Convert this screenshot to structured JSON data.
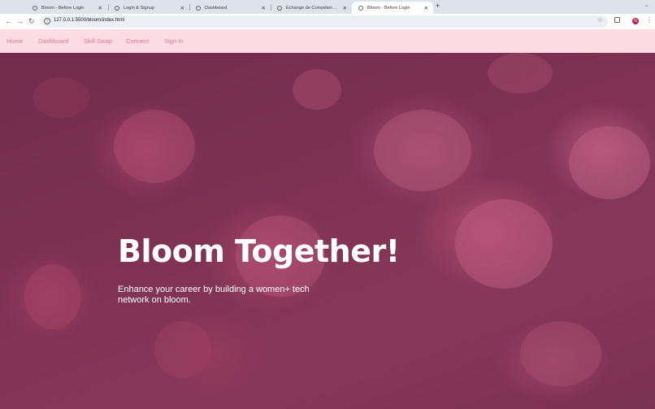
{
  "browser": {
    "tabs": [
      {
        "title": "Bloom - Before Login",
        "active": false
      },
      {
        "title": "Login & Signup",
        "active": false
      },
      {
        "title": "Dashboard",
        "active": false
      },
      {
        "title": "Échange de Compétences - S",
        "active": false
      },
      {
        "title": "Bloom - Before Login",
        "active": true
      }
    ],
    "new_tab": "+",
    "url": "127.0.0.1:5500/bloom/index.html",
    "profile_initial": "N"
  },
  "nav": {
    "items": [
      "Home",
      "Dashboard",
      "Skill Swap",
      "Connect",
      "Sign In"
    ]
  },
  "hero": {
    "title": "Bloom Together!",
    "subtitle": "Enhance your career by building a women+ tech network on bloom."
  },
  "colors": {
    "nav_background": "#fcdde5",
    "nav_link": "#e0749a",
    "hero_tint": "#8a3f5c",
    "hero_text": "#ffffff"
  }
}
